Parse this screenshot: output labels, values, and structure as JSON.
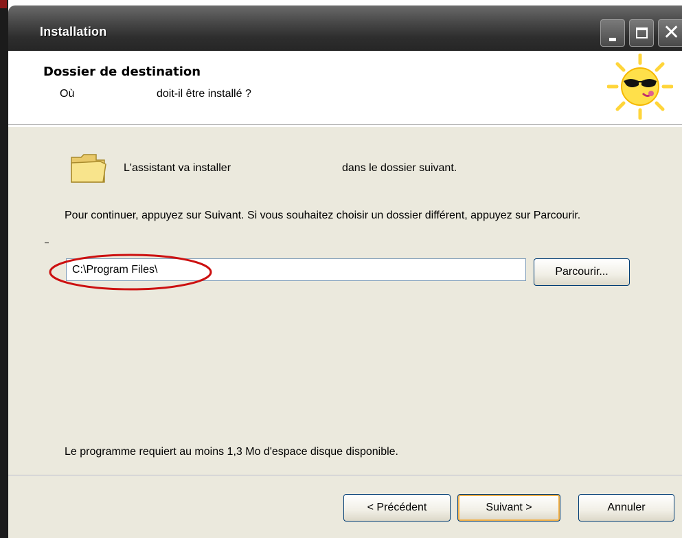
{
  "window": {
    "title": "Installation",
    "controls": [
      "minimize-icon",
      "maximize-icon",
      "close-icon"
    ],
    "close_glyph": "✕"
  },
  "header": {
    "title": "Dossier de destination",
    "subtitle_part1": "Où",
    "subtitle_part2": "doit-il être installé ?",
    "mascot_icon": "sun-with-sunglasses-icon"
  },
  "body": {
    "folder_icon": "folder-icon",
    "intro_part1": "L'assistant va installer",
    "intro_part2": "dans le dossier suivant.",
    "instructions": "Pour continuer, appuyez sur Suivant. Si vous souhaitez choisir un dossier différent, appuyez sur Parcourir.",
    "path_value": "C:\\Program Files\\",
    "browse_label": "Parcourir...",
    "space_requirement": "Le programme requiert au moins 1,3 Mo d'espace disque disponible."
  },
  "footer": {
    "prev_label": "< Précédent",
    "next_label": "Suivant >",
    "cancel_label": "Annuler"
  },
  "colors": {
    "titlebar": "#262626",
    "body_bg": "#ebe9dd",
    "highlight_ellipse": "#cc1010",
    "default_button_glow": "#f3b24a"
  }
}
